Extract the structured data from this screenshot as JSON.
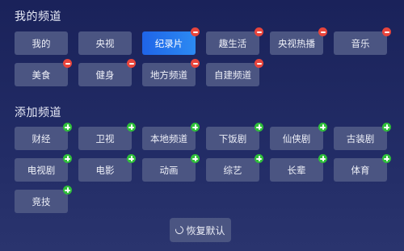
{
  "my_channels": {
    "title": "我的频道",
    "items": [
      {
        "label": "我的",
        "active": false,
        "removable": false
      },
      {
        "label": "央视",
        "active": false,
        "removable": false
      },
      {
        "label": "纪录片",
        "active": true,
        "removable": true
      },
      {
        "label": "趣生活",
        "active": false,
        "removable": true
      },
      {
        "label": "央视热播",
        "active": false,
        "removable": true
      },
      {
        "label": "音乐",
        "active": false,
        "removable": true
      },
      {
        "label": "美食",
        "active": false,
        "removable": true
      },
      {
        "label": "健身",
        "active": false,
        "removable": true
      },
      {
        "label": "地方频道",
        "active": false,
        "removable": true
      },
      {
        "label": "自建频道",
        "active": false,
        "removable": true
      }
    ]
  },
  "add_channels": {
    "title": "添加频道",
    "items": [
      {
        "label": "财经"
      },
      {
        "label": "卫视"
      },
      {
        "label": "本地频道"
      },
      {
        "label": "下饭剧"
      },
      {
        "label": "仙侠剧"
      },
      {
        "label": "古装剧"
      },
      {
        "label": "电视剧"
      },
      {
        "label": "电影"
      },
      {
        "label": "动画"
      },
      {
        "label": "综艺"
      },
      {
        "label": "长辈"
      },
      {
        "label": "体育"
      },
      {
        "label": "竞技"
      }
    ]
  },
  "restore_button": {
    "label": "恢复默认",
    "icon": "refresh-icon"
  }
}
